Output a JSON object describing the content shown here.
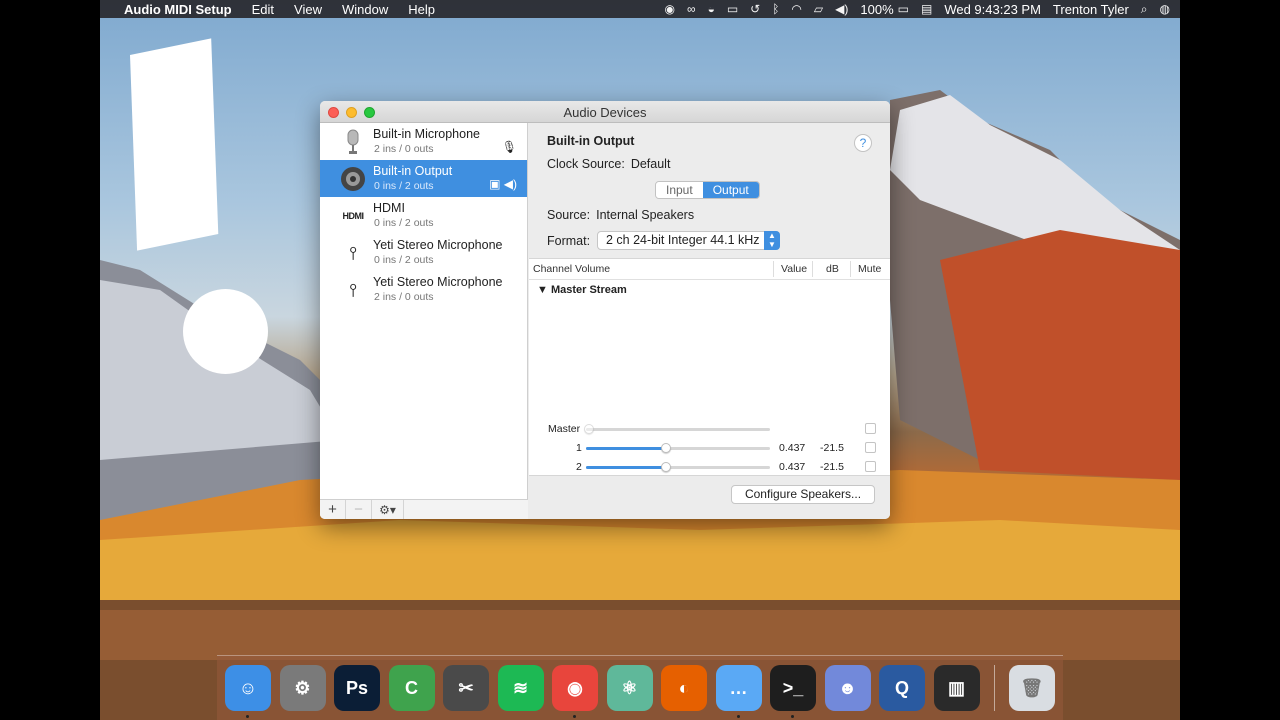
{
  "menubar": {
    "app_name": "Audio MIDI Setup",
    "menus": [
      "Edit",
      "View",
      "Window",
      "Help"
    ],
    "battery": "100%",
    "clock": "Wed 9:43:23 PM",
    "user": "Trenton Tyler"
  },
  "window": {
    "title": "Audio Devices",
    "devices": [
      {
        "name": "Built-in Microphone",
        "io": "2 ins / 0 outs",
        "icon": "microphone-icon",
        "selected": false
      },
      {
        "name": "Built-in Output",
        "io": "0 ins / 2 outs",
        "icon": "speaker-icon",
        "selected": true
      },
      {
        "name": "HDMI",
        "io": "0 ins / 2 outs",
        "icon": "hdmi-icon",
        "selected": false
      },
      {
        "name": "Yeti Stereo Microphone",
        "io": "0 ins / 2 outs",
        "icon": "usb-icon",
        "selected": false
      },
      {
        "name": "Yeti Stereo Microphone",
        "io": "2 ins / 0 outs",
        "icon": "usb-icon",
        "selected": false
      }
    ],
    "footer": {
      "add": "+",
      "remove": "−",
      "gear": "⚙▾"
    },
    "detail": {
      "device_title": "Built-in Output",
      "help": "?",
      "clock_label": "Clock Source:",
      "clock_value": "Default",
      "tabs": [
        "Input",
        "Output"
      ],
      "active_tab": "Output",
      "source_label": "Source:",
      "source_value": "Internal Speakers",
      "format_label": "Format:",
      "format_value": "2 ch 24-bit Integer 44.1 kHz",
      "columns": {
        "channel": "Channel Volume",
        "value": "Value",
        "db": "dB",
        "mute": "Mute"
      },
      "stream_name": "Master Stream",
      "rows": [
        {
          "label": "Master",
          "level": 0.0,
          "value": "",
          "db": "",
          "enabled": false
        },
        {
          "label": "1",
          "level": 0.437,
          "value": "0.437",
          "db": "-21.5",
          "enabled": true
        },
        {
          "label": "2",
          "level": 0.437,
          "value": "0.437",
          "db": "-21.5",
          "enabled": true
        }
      ],
      "configure_button": "Configure Speakers..."
    }
  },
  "dock": {
    "apps": [
      {
        "name": "finder-icon",
        "color": "#3d8fe6",
        "glyph": "☺"
      },
      {
        "name": "system-preferences-icon",
        "color": "#7a7a7a",
        "glyph": "⚙"
      },
      {
        "name": "photoshop-icon",
        "color": "#0b1e36",
        "glyph": "Ps"
      },
      {
        "name": "camtasia-icon",
        "color": "#3fa34d",
        "glyph": "C"
      },
      {
        "name": "final-cut-icon",
        "color": "#4a4a4a",
        "glyph": "✂"
      },
      {
        "name": "spotify-icon",
        "color": "#1db954",
        "glyph": "≋"
      },
      {
        "name": "chrome-icon",
        "color": "#e8453c",
        "glyph": "◉"
      },
      {
        "name": "atom-icon",
        "color": "#5fb89a",
        "glyph": "⚛"
      },
      {
        "name": "firefox-icon",
        "color": "#e66000",
        "glyph": "◐"
      },
      {
        "name": "messages-icon",
        "color": "#5aa9f5",
        "glyph": "…"
      },
      {
        "name": "terminal-icon",
        "color": "#1e1e1e",
        "glyph": ">_"
      },
      {
        "name": "discord-icon",
        "color": "#7289da",
        "glyph": "☻"
      },
      {
        "name": "quicktime-icon",
        "color": "#2a5aa0",
        "glyph": "Q"
      },
      {
        "name": "midi-keyboard-icon",
        "color": "#2a2a2a",
        "glyph": "▥"
      }
    ],
    "trash": {
      "name": "trash-icon",
      "color": "#d9dde2",
      "glyph": "🗑"
    }
  }
}
